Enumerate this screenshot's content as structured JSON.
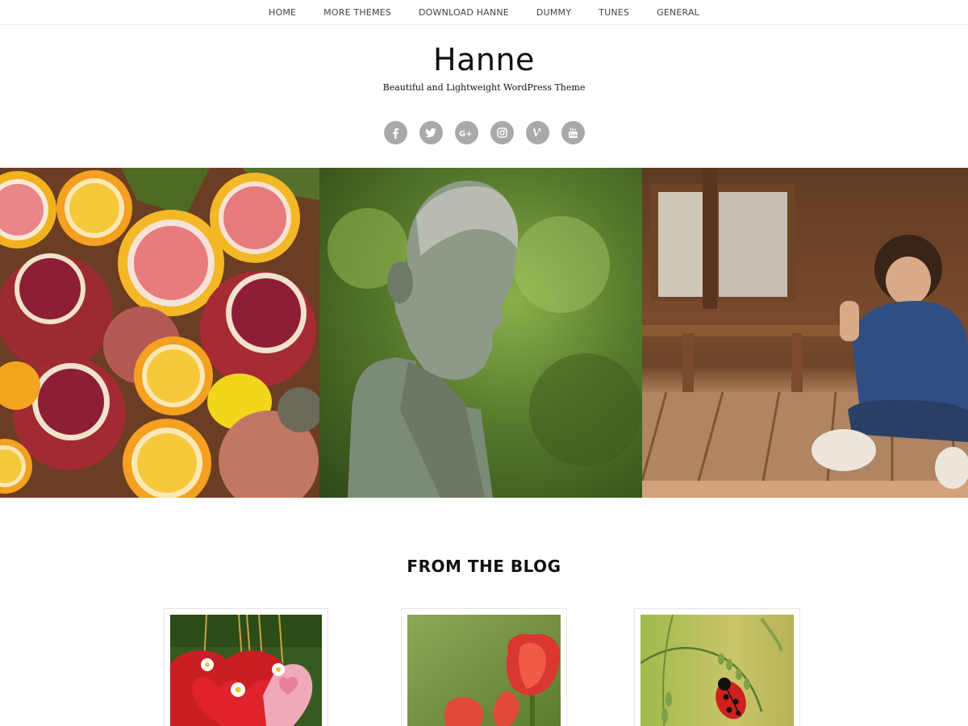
{
  "nav": {
    "items": [
      {
        "label": "HOME"
      },
      {
        "label": "MORE THEMES"
      },
      {
        "label": "DOWNLOAD HANNE"
      },
      {
        "label": "DUMMY"
      },
      {
        "label": "TUNES"
      },
      {
        "label": "GENERAL"
      }
    ]
  },
  "header": {
    "title": "Hanne",
    "tagline": "Beautiful and Lightweight WordPress Theme"
  },
  "social": {
    "icons": [
      "facebook-icon",
      "twitter-icon",
      "google-plus-icon",
      "instagram-icon",
      "vine-icon",
      "youtube-icon"
    ],
    "color": "#a9a9a9"
  },
  "hero": {
    "images": [
      "citrus-and-pomegranate-photo",
      "boy-statue-photo",
      "child-on-porch-photo"
    ]
  },
  "blog": {
    "heading": "FROM THE BLOG",
    "posts": [
      {
        "image": "felt-hearts-photo"
      },
      {
        "image": "red-tulips-photo"
      },
      {
        "image": "ladybug-photo"
      }
    ]
  }
}
